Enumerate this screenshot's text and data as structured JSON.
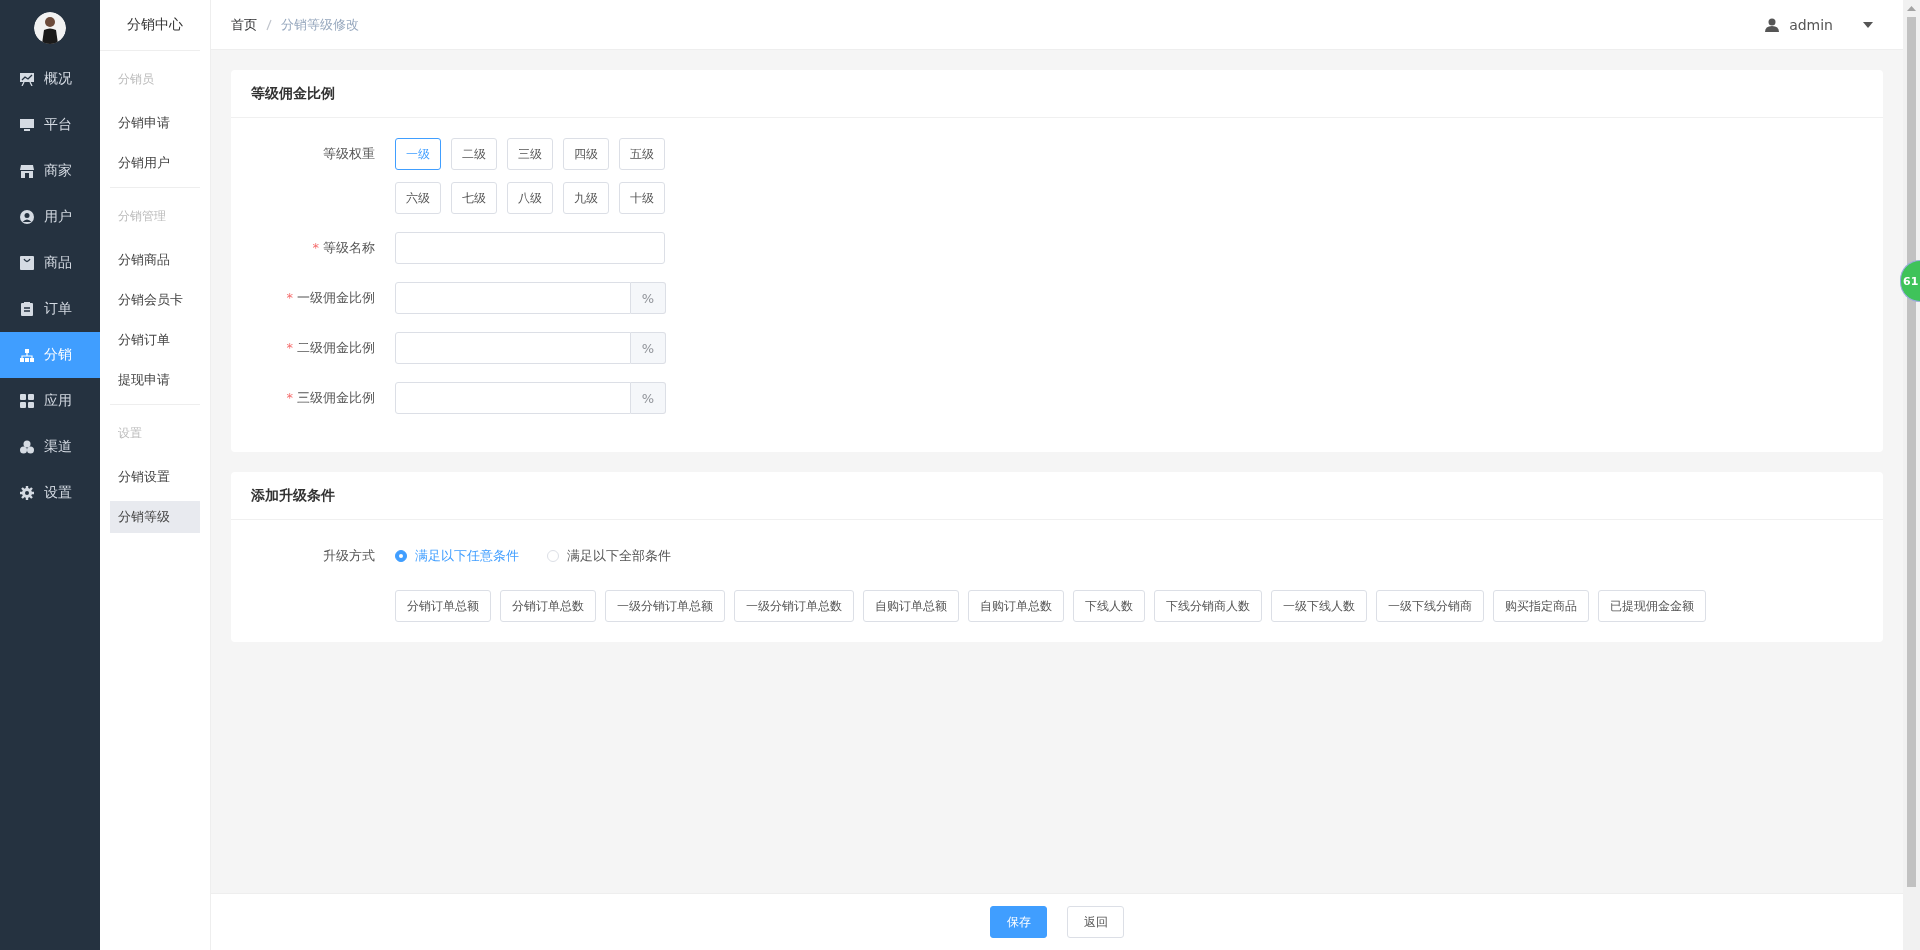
{
  "nav_rail": {
    "items": [
      {
        "label": "概况",
        "selected": false
      },
      {
        "label": "平台",
        "selected": false
      },
      {
        "label": "商家",
        "selected": false
      },
      {
        "label": "用户",
        "selected": false
      },
      {
        "label": "商品",
        "selected": false
      },
      {
        "label": "订单",
        "selected": false
      },
      {
        "label": "分销",
        "selected": true
      },
      {
        "label": "应用",
        "selected": false
      },
      {
        "label": "渠道",
        "selected": false
      },
      {
        "label": "设置",
        "selected": false
      }
    ]
  },
  "submenu": {
    "title": "分销中心",
    "groups": [
      {
        "title": "分销员",
        "items": [
          {
            "label": "分销申请",
            "selected": false
          },
          {
            "label": "分销用户",
            "selected": false
          }
        ]
      },
      {
        "title": "分销管理",
        "items": [
          {
            "label": "分销商品",
            "selected": false
          },
          {
            "label": "分销会员卡",
            "selected": false
          },
          {
            "label": "分销订单",
            "selected": false
          },
          {
            "label": "提现申请",
            "selected": false
          }
        ]
      },
      {
        "title": "设置",
        "items": [
          {
            "label": "分销设置",
            "selected": false
          },
          {
            "label": "分销等级",
            "selected": true
          }
        ]
      }
    ]
  },
  "header": {
    "breadcrumb": [
      "首页",
      "分销等级修改"
    ],
    "user": "admin"
  },
  "commission_card": {
    "title": "等级佣金比例",
    "required_mark": "*",
    "weight_label": "等级权重",
    "levels": [
      {
        "label": "一级",
        "selected": true
      },
      {
        "label": "二级",
        "selected": false
      },
      {
        "label": "三级",
        "selected": false
      },
      {
        "label": "四级",
        "selected": false
      },
      {
        "label": "五级",
        "selected": false
      },
      {
        "label": "六级",
        "selected": false
      },
      {
        "label": "七级",
        "selected": false
      },
      {
        "label": "八级",
        "selected": false
      },
      {
        "label": "九级",
        "selected": false
      },
      {
        "label": "十级",
        "selected": false
      }
    ],
    "fields": [
      {
        "label": "等级名称",
        "required": true
      },
      {
        "label": "一级佣金比例",
        "required": true,
        "suffix": "%"
      },
      {
        "label": "二级佣金比例",
        "required": true,
        "suffix": "%"
      },
      {
        "label": "三级佣金比例",
        "required": true,
        "suffix": "%"
      }
    ]
  },
  "upgrade_card": {
    "title": "添加升级条件",
    "mode_label": "升级方式",
    "modes": [
      {
        "label": "满足以下任意条件",
        "selected": true
      },
      {
        "label": "满足以下全部条件",
        "selected": false
      }
    ],
    "conditions": [
      "分销订单总额",
      "分销订单总数",
      "一级分销订单总额",
      "一级分销订单总数",
      "自购订单总额",
      "自购订单总数",
      "下线人数",
      "下线分销商人数",
      "一级下线人数",
      "一级下线分销商",
      "购买指定商品",
      "已提现佣金金额"
    ]
  },
  "footer": {
    "buttons": [
      {
        "label": "保存",
        "kind": "primary"
      },
      {
        "label": "返回",
        "kind": "default"
      }
    ]
  },
  "floating_badge": "61"
}
